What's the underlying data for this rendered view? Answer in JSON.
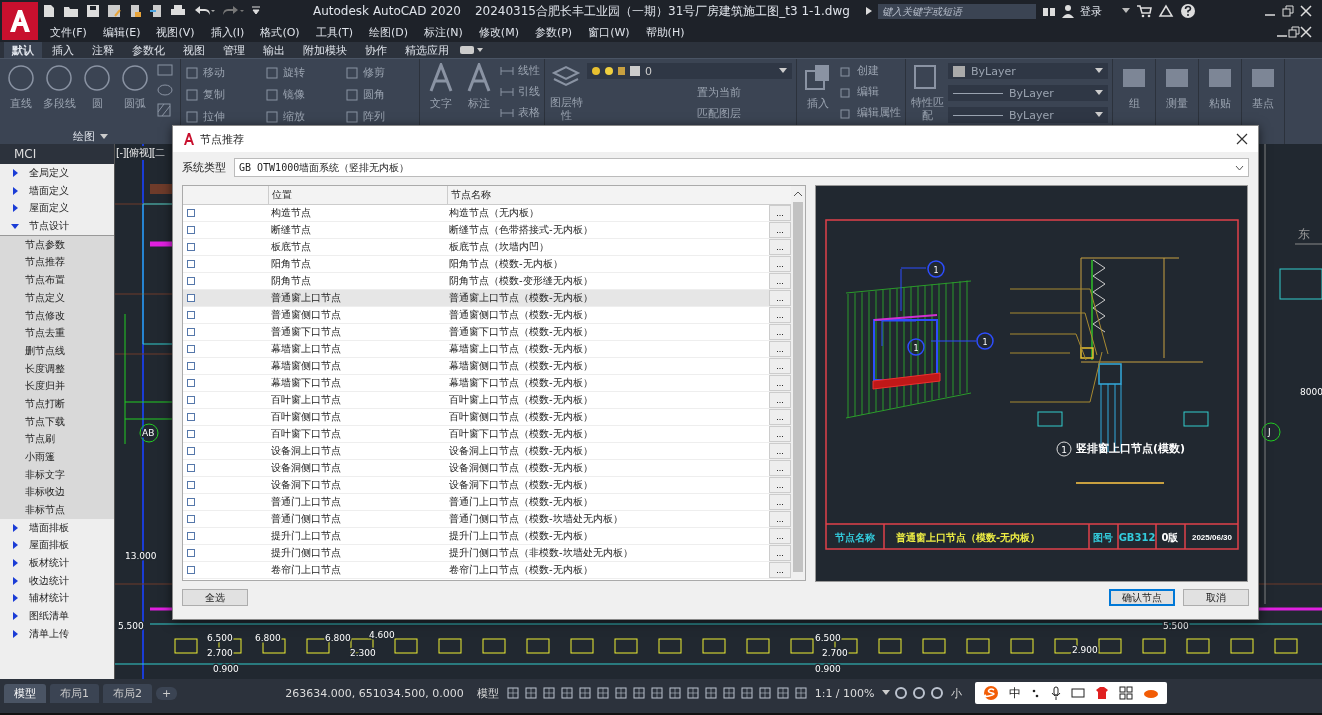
{
  "title_bar": {
    "app_title": "Autodesk AutoCAD 2020",
    "file_title": "20240315合肥长丰工业园（一期）31号厂房建筑施工图_t3 1-1.dwg",
    "search": {
      "placeholder": "键入关键字或短语"
    },
    "sign_in": "登录"
  },
  "menu": [
    "文件(F)",
    "编辑(E)",
    "视图(V)",
    "插入(I)",
    "格式(O)",
    "工具(T)",
    "绘图(D)",
    "标注(N)",
    "修改(M)",
    "参数(P)",
    "窗口(W)",
    "帮助(H)"
  ],
  "ribbon_tabs": [
    {
      "label": "默认",
      "selected": true
    },
    {
      "label": "插入",
      "selected": false
    },
    {
      "label": "注释",
      "selected": false
    },
    {
      "label": "参数化",
      "selected": false
    },
    {
      "label": "视图",
      "selected": false
    },
    {
      "label": "管理",
      "selected": false
    },
    {
      "label": "输出",
      "selected": false
    },
    {
      "label": "附加模块",
      "selected": false
    },
    {
      "label": "协作",
      "selected": false
    },
    {
      "label": "精选应用",
      "selected": false
    }
  ],
  "ribbon": {
    "draw": {
      "tools": [
        "直线",
        "多段线",
        "圆",
        "圆弧"
      ],
      "panel_label": "绘图"
    },
    "modify": [
      "移动",
      "旋转",
      "修剪",
      "复制",
      "镜像",
      "圆角",
      "拉伸",
      "缩放",
      "阵列"
    ],
    "annotation": {
      "big": [
        "文字",
        "标注"
      ],
      "small": [
        "线性",
        "引线",
        "表格"
      ]
    },
    "layers": {
      "big": "图层特性",
      "current_layer": "0",
      "small": [
        "置为当前",
        "匹配图层"
      ]
    },
    "block": {
      "big": "插入",
      "small": [
        "创建",
        "编辑",
        "编辑属性"
      ]
    },
    "properties": {
      "big": "特性匹配",
      "values": [
        "ByLayer",
        "ByLayer",
        "ByLayer"
      ]
    },
    "tools": [
      "组",
      "测量",
      "粘贴",
      "基点"
    ]
  },
  "sidebar": {
    "title": "MCI",
    "items": [
      {
        "label": "全局定义",
        "expanded": false
      },
      {
        "label": "墙面定义",
        "expanded": false
      },
      {
        "label": "屋面定义",
        "expanded": false
      },
      {
        "label": "节点设计",
        "expanded": true,
        "children": [
          {
            "label": "节点参数"
          },
          {
            "label": "节点推荐"
          },
          {
            "label": "节点布置"
          },
          {
            "label": "节点定义"
          },
          {
            "label": "节点修改"
          },
          {
            "label": "节点去重"
          },
          {
            "label": "删节点线"
          },
          {
            "label": "长度调整"
          },
          {
            "label": "长度归并"
          },
          {
            "label": "节点打断"
          },
          {
            "label": "节点下载"
          },
          {
            "label": "节点刷"
          },
          {
            "label": "小雨篷"
          },
          {
            "label": "非标文字"
          },
          {
            "label": "非标收边"
          },
          {
            "label": "非标节点"
          }
        ]
      },
      {
        "label": "墙面排板",
        "expanded": false
      },
      {
        "label": "屋面排板",
        "expanded": false
      },
      {
        "label": "板材统计",
        "expanded": false
      },
      {
        "label": "收边统计",
        "expanded": false
      },
      {
        "label": "辅材统计",
        "expanded": false
      },
      {
        "label": "图纸清单",
        "expanded": false
      },
      {
        "label": "清单上传",
        "expanded": false
      }
    ]
  },
  "viewport": {
    "label": "[-][俯视][二",
    "viewcube_label": "东",
    "labels": [
      "13.000",
      "5.500",
      "AB",
      "J",
      "8000",
      "6.500",
      "6.800",
      "6.800",
      "4.600",
      "2.700",
      "2.300",
      "0.900",
      "6.500",
      "2.700",
      "5.500",
      "2.900",
      "0.900"
    ]
  },
  "dialog": {
    "title": "节点推荐",
    "system_type": {
      "label": "系统类型",
      "value": "GB OTW1000墙面系统（竖排无内板）"
    },
    "columns": [
      "位置",
      "节点名称"
    ],
    "rows": [
      {
        "checked": false,
        "selected": false,
        "position": "构造节点",
        "node_name": "构造节点（无内板）",
        "more": "..."
      },
      {
        "checked": false,
        "selected": false,
        "position": "断缝节点",
        "node_name": "断缝节点（色带搭接式-无内板）",
        "more": "..."
      },
      {
        "checked": false,
        "selected": false,
        "position": "板底节点",
        "node_name": "板底节点（坎墙内凹）",
        "more": "..."
      },
      {
        "checked": false,
        "selected": false,
        "position": "阳角节点",
        "node_name": "阳角节点（模数-无内板）",
        "more": "..."
      },
      {
        "checked": false,
        "selected": false,
        "position": "阴角节点",
        "node_name": "阴角节点（模数-变形缝无内板）",
        "more": "..."
      },
      {
        "checked": false,
        "selected": true,
        "position": "普通窗上口节点",
        "node_name": "普通窗上口节点（模数-无内板）",
        "more": "..."
      },
      {
        "checked": false,
        "selected": false,
        "position": "普通窗侧口节点",
        "node_name": "普通窗侧口节点（模数-无内板）",
        "more": "..."
      },
      {
        "checked": false,
        "selected": false,
        "position": "普通窗下口节点",
        "node_name": "普通窗下口节点（模数-无内板）",
        "more": "..."
      },
      {
        "checked": false,
        "selected": false,
        "position": "幕墙窗上口节点",
        "node_name": "幕墙窗上口节点（模数-无内板）",
        "more": "..."
      },
      {
        "checked": false,
        "selected": false,
        "position": "幕墙窗侧口节点",
        "node_name": "幕墙窗侧口节点（模数-无内板）",
        "more": "..."
      },
      {
        "checked": false,
        "selected": false,
        "position": "幕墙窗下口节点",
        "node_name": "幕墙窗下口节点（模数-无内板）",
        "more": "..."
      },
      {
        "checked": false,
        "selected": false,
        "position": "百叶窗上口节点",
        "node_name": "百叶窗上口节点（模数-无内板）",
        "more": "..."
      },
      {
        "checked": false,
        "selected": false,
        "position": "百叶窗侧口节点",
        "node_name": "百叶窗侧口节点（模数-无内板）",
        "more": "..."
      },
      {
        "checked": false,
        "selected": false,
        "position": "百叶窗下口节点",
        "node_name": "百叶窗下口节点（模数-无内板）",
        "more": "..."
      },
      {
        "checked": false,
        "selected": false,
        "position": "设备洞上口节点",
        "node_name": "设备洞上口节点（模数-无内板）",
        "more": "..."
      },
      {
        "checked": false,
        "selected": false,
        "position": "设备洞侧口节点",
        "node_name": "设备洞侧口节点（模数-无内板）",
        "more": "..."
      },
      {
        "checked": false,
        "selected": false,
        "position": "设备洞下口节点",
        "node_name": "设备洞下口节点（模数-无内板）",
        "more": "..."
      },
      {
        "checked": false,
        "selected": false,
        "position": "普通门上口节点",
        "node_name": "普通门上口节点（模数-无内板）",
        "more": "..."
      },
      {
        "checked": false,
        "selected": false,
        "position": "普通门侧口节点",
        "node_name": "普通门侧口节点（模数-坎墙处无内板）",
        "more": "..."
      },
      {
        "checked": false,
        "selected": false,
        "position": "提升门上口节点",
        "node_name": "提升门上口节点（模数-无内板）",
        "more": "..."
      },
      {
        "checked": false,
        "selected": false,
        "position": "提升门侧口节点",
        "node_name": "提升门侧口节点（非模数-坎墙处无内板）",
        "more": "..."
      },
      {
        "checked": false,
        "selected": false,
        "position": "卷帘门上口节点",
        "node_name": "卷帘门上口节点（模数-无内板）",
        "more": "..."
      }
    ],
    "preview": {
      "callouts": [
        "1",
        "1",
        "1"
      ],
      "detail_index": "1",
      "detail_title": "竖排窗上口节点(模数)",
      "title_block": {
        "name_label": "节点名称",
        "name": "普通窗上口节点（模数-无内板）",
        "number_label": "图号",
        "number": "GB312",
        "version": "0版",
        "date": "2025/06/30"
      }
    },
    "buttons": {
      "select_all": "全选",
      "confirm": "确认节点",
      "cancel": "取消"
    }
  },
  "status_bar": {
    "layout_tabs": [
      {
        "label": "模型",
        "selected": true
      },
      {
        "label": "布局1",
        "selected": false
      },
      {
        "label": "布局2",
        "selected": false
      }
    ],
    "add_tab": "+",
    "coordinates": "263634.000, 651034.500, 0.000",
    "space": "模型",
    "scale": "1:1 / 100%",
    "workspace": "小",
    "ime_mode": "中"
  }
}
